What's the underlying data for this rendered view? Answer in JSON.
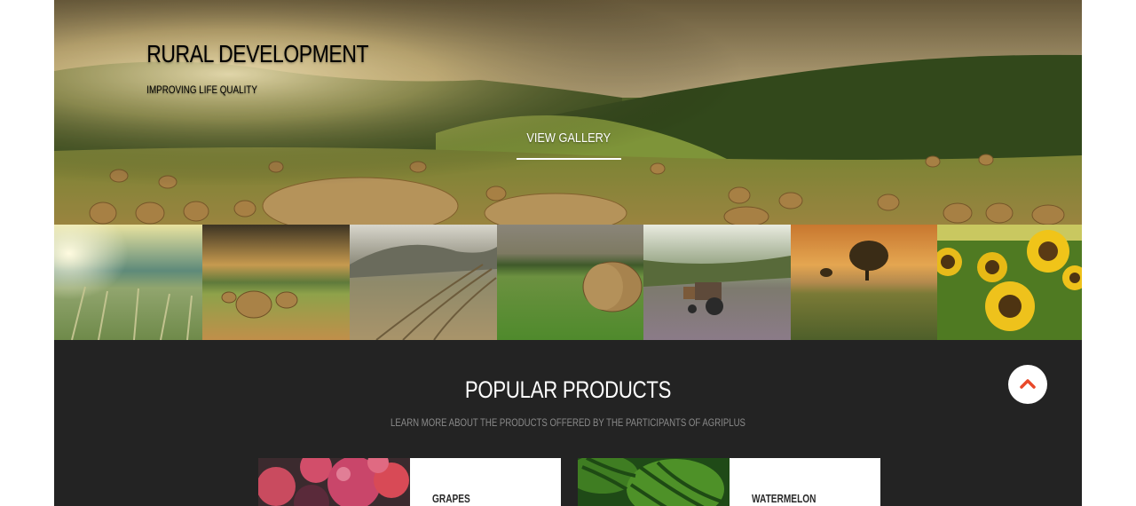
{
  "hero": {
    "title": "RURAL DEVELOPMENT",
    "subtitle": "IMPROVING LIFE QUALITY",
    "button_label": "VIEW GALLERY"
  },
  "gallery": {
    "thumbnails": [
      "wheat-field-sunrise",
      "hay-bales-sunset",
      "plowed-field-mist",
      "hay-bale-meadow",
      "tractor-field",
      "lone-tree-sunset",
      "sunflowers"
    ]
  },
  "products": {
    "title": "POPULAR PRODUCTS",
    "subtitle": "LEARN MORE ABOUT THE PRODUCTS OFFERED BY THE PARTICIPANTS OF AGRIPLUS",
    "items": [
      {
        "name": "GRAPES"
      },
      {
        "name": "WATERMELON"
      }
    ]
  },
  "scroll_top": {
    "icon": "chevron-up-icon",
    "color": "#e8492a"
  },
  "colors": {
    "dark_bg": "#232323",
    "accent": "#e8492a"
  }
}
